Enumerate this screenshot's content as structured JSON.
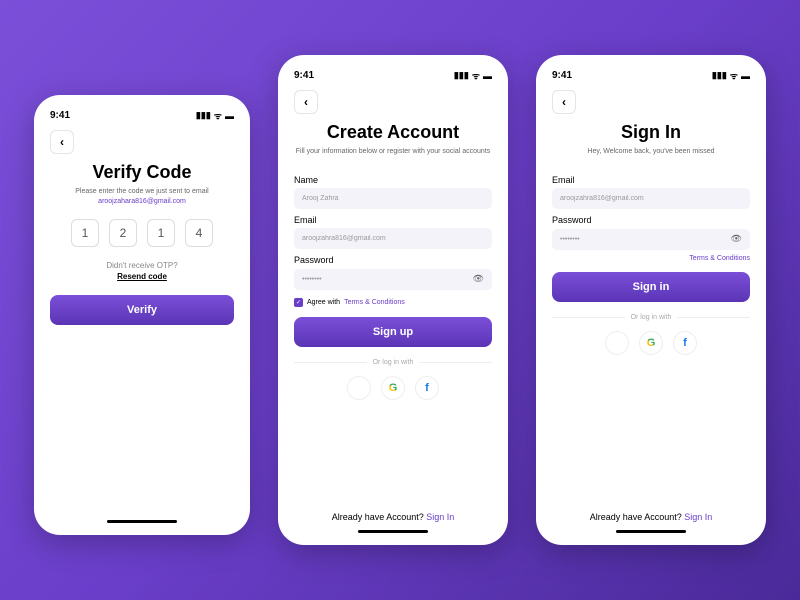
{
  "status_time": "9:41",
  "verify": {
    "title": "Verify Code",
    "subtitle": "Please enter the code we just sent to email",
    "email": "aroojzahara816@gmail.com",
    "digits": [
      "1",
      "2",
      "1",
      "4"
    ],
    "resend_q": "Didn't receive OTP?",
    "resend": "Resend code",
    "button": "Verify"
  },
  "create": {
    "title": "Create Account",
    "subtitle": "Fill your information below or register with your social accounts",
    "name_label": "Name",
    "name_value": "Arooj Zahra",
    "email_label": "Email",
    "email_value": "aroojzahra816@gmail.com",
    "password_label": "Password",
    "password_value": "••••••••",
    "agree": "Agree with",
    "terms": "Terms & Conditions",
    "button": "Sign up",
    "divider": "Or log in  with",
    "footer": "Already have Account? ",
    "footer_link": "Sign In"
  },
  "signin": {
    "title": "Sign In",
    "subtitle": "Hey, Welcome back, you've been missed",
    "email_label": "Email",
    "email_value": "aroojzahra816@gmail.com",
    "password_label": "Password",
    "password_value": "••••••••",
    "terms": "Terms & Conditions",
    "button": "Sign in",
    "divider": "Or log in  with",
    "footer": "Already have Account? ",
    "footer_link": "Sign In"
  }
}
